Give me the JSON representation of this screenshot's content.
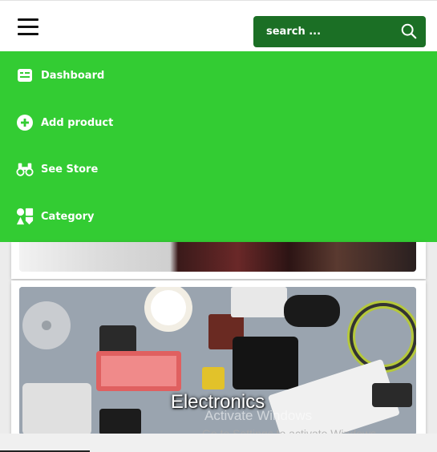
{
  "header": {
    "menu_icon": "hamburger-menu-icon",
    "search": {
      "placeholder": "search ...",
      "icon": "search-icon"
    },
    "accent": "#1b6f25"
  },
  "menu": {
    "background": "#33cc33",
    "items": [
      {
        "label": "Dashboard",
        "icon": "dashboard-icon"
      },
      {
        "label": "Add product",
        "icon": "plus-circle-icon"
      },
      {
        "label": "See Store",
        "icon": "binoculars-icon"
      },
      {
        "label": "Category",
        "icon": "shapes-icon"
      }
    ]
  },
  "cards": [
    {
      "title": ""
    },
    {
      "title": "Electronics"
    }
  ],
  "watermark": {
    "line1": "Activate Windows",
    "line2": "Go to Settings to activate Windows."
  }
}
